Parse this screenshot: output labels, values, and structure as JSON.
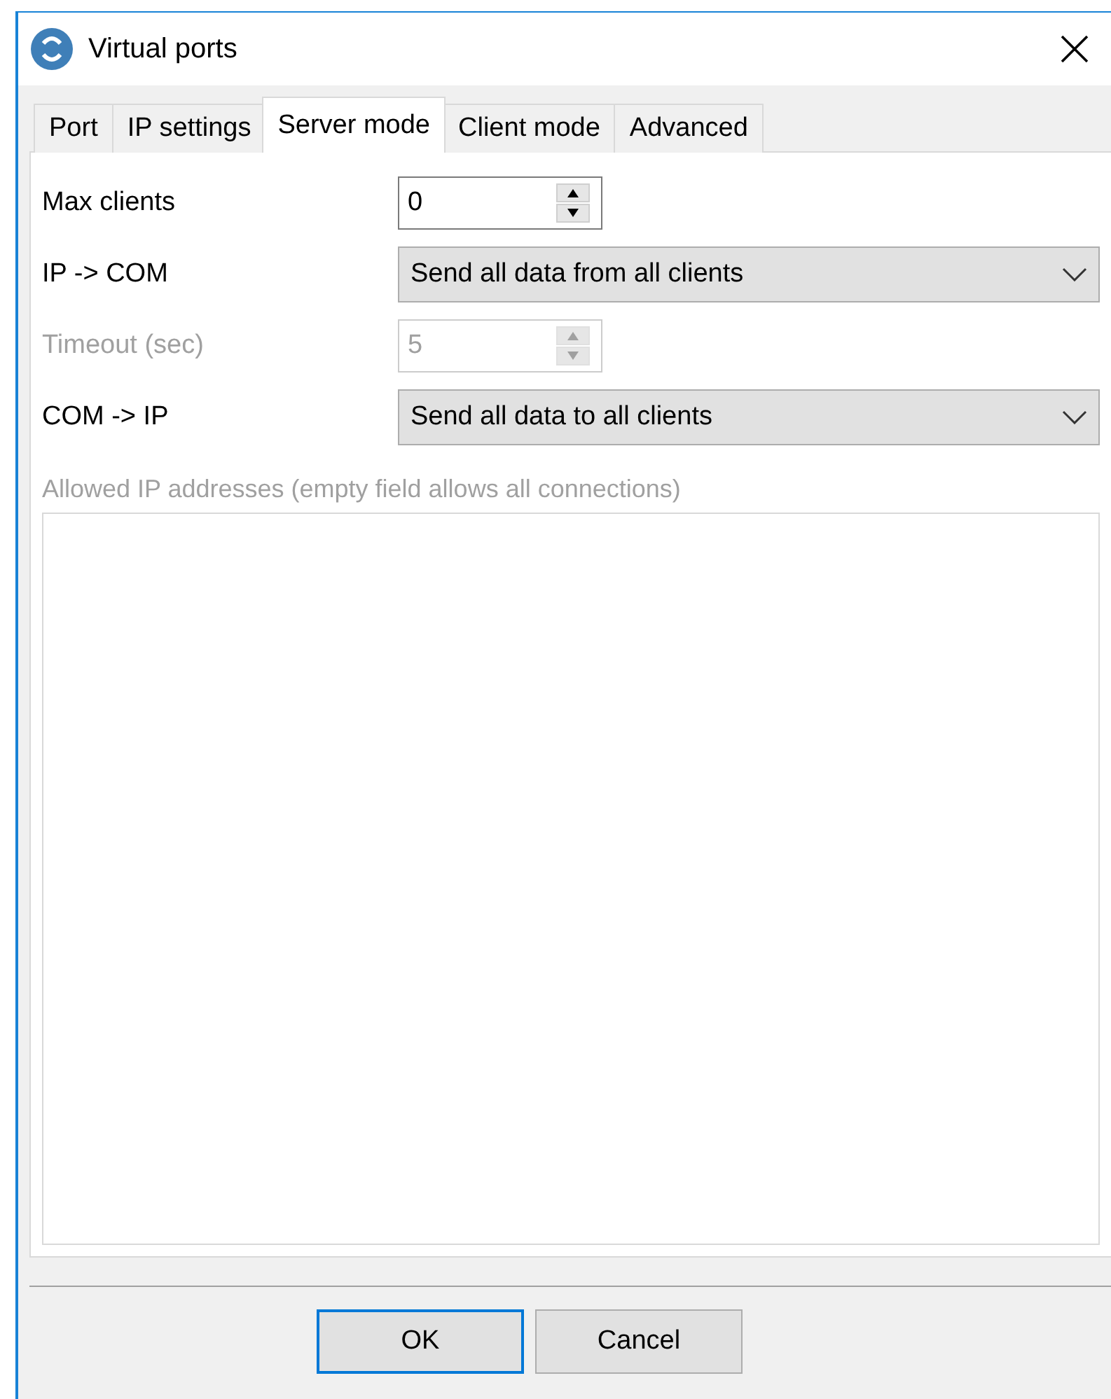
{
  "window": {
    "title": "Virtual ports"
  },
  "tabs": [
    {
      "label": "Port",
      "selected": false
    },
    {
      "label": "IP settings",
      "selected": false
    },
    {
      "label": "Server mode",
      "selected": true
    },
    {
      "label": "Client mode",
      "selected": false
    },
    {
      "label": "Advanced",
      "selected": false
    }
  ],
  "fields": [
    {
      "kind": "spin",
      "label": "Max clients",
      "value": "0",
      "disabled": false
    },
    {
      "kind": "dropdown",
      "label": "IP -> COM",
      "value": "Send all data from all clients",
      "disabled": false
    },
    {
      "kind": "spin",
      "label": "Timeout (sec)",
      "value": "5",
      "disabled": true
    },
    {
      "kind": "dropdown",
      "label": "COM -> IP",
      "value": "Send all data to all clients",
      "disabled": false
    }
  ],
  "allowed_ips": {
    "label": "Allowed IP addresses (empty field allows all connections)",
    "disabled": true
  },
  "buttons": [
    {
      "label": "OK",
      "default": true
    },
    {
      "label": "Cancel",
      "default": false
    }
  ]
}
